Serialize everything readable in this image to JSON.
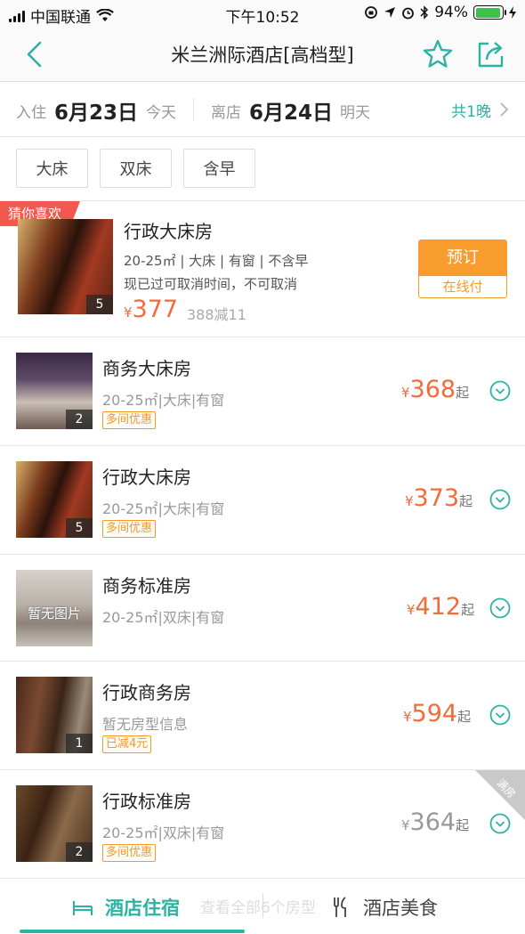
{
  "status": {
    "carrier": "中国联通",
    "time": "下午10:52",
    "battery": "94%",
    "battery_level": 0.94
  },
  "nav": {
    "title": "米兰洲际酒店[高档型]"
  },
  "dates": {
    "checkin_label": "入住",
    "checkin_date": "6月23日",
    "checkin_sub": "今天",
    "checkout_label": "离店",
    "checkout_date": "6月24日",
    "checkout_sub": "明天",
    "nights": "共1晚"
  },
  "filters": [
    "大床",
    "双床",
    "含早"
  ],
  "featured": {
    "tag": "猜你喜欢",
    "name": "行政大床房",
    "spec": "20-25㎡ | 大床 | 有窗 | 不含早",
    "cancel": "现已过可取消时间，不可取消",
    "currency": "¥",
    "price": "377",
    "original": "388减11",
    "photo_count": "5",
    "book_label": "预订",
    "pay_label": "在线付"
  },
  "rooms": [
    {
      "name": "商务大床房",
      "spec": "20-25㎡|大床|有窗",
      "badge": "多间优惠",
      "currency": "¥",
      "price": "368",
      "suffix": "起",
      "photo_count": "2"
    },
    {
      "name": "行政大床房",
      "spec": "20-25㎡|大床|有窗",
      "badge": "多间优惠",
      "currency": "¥",
      "price": "373",
      "suffix": "起",
      "photo_count": "5"
    },
    {
      "name": "商务标准房",
      "spec": "20-25㎡|双床|有窗",
      "currency": "¥",
      "price": "412",
      "suffix": "起",
      "no_image": "暂无图片"
    },
    {
      "name": "行政商务房",
      "spec": "暂无房型信息",
      "badge": "已减4元",
      "currency": "¥",
      "price": "594",
      "suffix": "起",
      "photo_count": "1"
    },
    {
      "name": "行政标准房",
      "spec": "20-25㎡|双床|有窗",
      "badge": "多间优惠",
      "currency": "¥",
      "price": "364",
      "suffix": "起",
      "photo_count": "2",
      "ribbon": "满房"
    }
  ],
  "ghost_text": "查看全部6个房型",
  "tabs": [
    {
      "label": "酒店住宿",
      "icon": "bed-icon"
    },
    {
      "label": "酒店美食",
      "icon": "fork-knife-icon"
    }
  ],
  "colors": {
    "accent": "#2bb3a4",
    "price": "#f26b3a",
    "book": "#f89c2e",
    "featured_tag": "#f2584e",
    "full_price": "#999999"
  }
}
